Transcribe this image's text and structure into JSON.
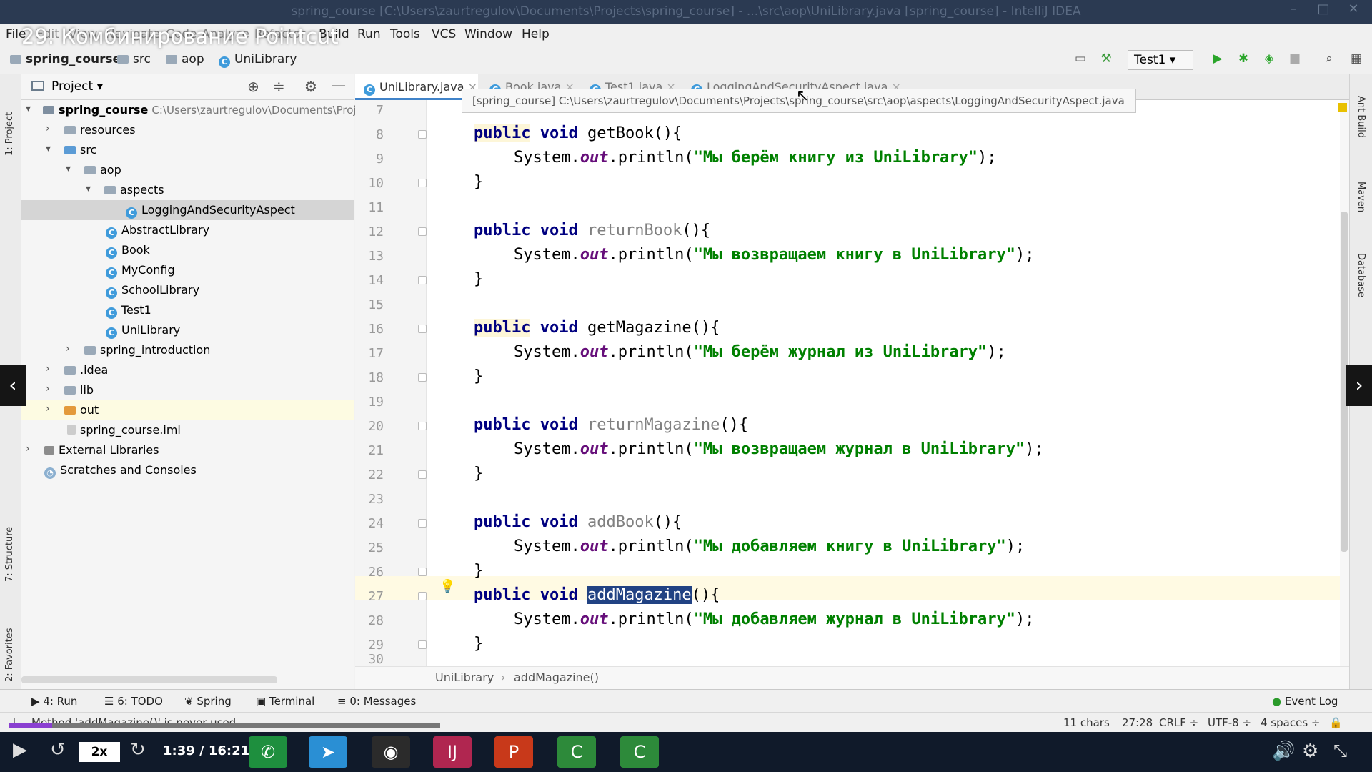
{
  "window": {
    "title": "spring_course [C:\\Users\\zaurtregulov\\Documents\\Projects\\spring_course] - ...\\src\\aop\\UniLibrary.java [spring_course] - IntelliJ IDEA"
  },
  "video": {
    "lesson_title": "29. Комбинирование Pointcut",
    "speed": "2x",
    "time": "1:39 / 16:21",
    "progress": 0.101
  },
  "menu": [
    "File",
    "Edit",
    "View",
    "Navigate",
    "Code",
    "Analyze",
    "Refactor",
    "Build",
    "Run",
    "Tools",
    "VCS",
    "Window",
    "Help"
  ],
  "breadcrumb": [
    "spring_course",
    "src",
    "aop",
    "UniLibrary"
  ],
  "run_config": "Test1",
  "project": {
    "header": "Project",
    "tree": [
      {
        "label": "spring_course",
        "hint": "C:\\Users\\zaurtregulov\\Documents\\Proj"
      },
      {
        "label": "resources"
      },
      {
        "label": "src"
      },
      {
        "label": "aop"
      },
      {
        "label": "aspects"
      },
      {
        "label": "LoggingAndSecurityAspect"
      },
      {
        "label": "AbstractLibrary"
      },
      {
        "label": "Book"
      },
      {
        "label": "MyConfig"
      },
      {
        "label": "SchoolLibrary"
      },
      {
        "label": "Test1"
      },
      {
        "label": "UniLibrary"
      },
      {
        "label": "spring_introduction"
      },
      {
        "label": ".idea"
      },
      {
        "label": "lib"
      },
      {
        "label": "out"
      },
      {
        "label": "spring_course.iml"
      },
      {
        "label": "External Libraries"
      },
      {
        "label": "Scratches and Consoles"
      }
    ]
  },
  "tabs": [
    "UniLibrary.java",
    "Book.java",
    "Test1.java",
    "LoggingAndSecurityAspect.java"
  ],
  "tooltip": "[spring_course] C:\\Users\\zaurtregulov\\Documents\\Projects\\spring_course\\src\\aop\\aspects\\LoggingAndSecurityAspect.java",
  "code": {
    "line_numbers": [
      "7",
      "8",
      "9",
      "10",
      "11",
      "12",
      "13",
      "14",
      "15",
      "16",
      "17",
      "18",
      "19",
      "20",
      "21",
      "22",
      "23",
      "24",
      "25",
      "26",
      "27",
      "28",
      "29",
      "30"
    ],
    "kw_public": "public",
    "kw_void": "void",
    "sys": "System.",
    "out": "out",
    "println": ".println(",
    "close_stmt": ");",
    "parens": "(){",
    "brace": "}",
    "methods": [
      "getBook",
      "returnBook",
      "getMagazine",
      "returnMagazine",
      "addBook",
      "addMagazine"
    ],
    "strings": [
      "\"Мы берём книгу из UniLibrary\"",
      "\"Мы возвращаем книгу в UniLibrary\"",
      "\"Мы берём журнал из UniLibrary\"",
      "\"Мы возвращаем журнал в UniLibrary\"",
      "\"Мы добавляем книгу в UniLibrary\"",
      "\"Мы добавляем журнал в UniLibrary\""
    ]
  },
  "editor_breadcrumb": [
    "UniLibrary",
    "addMagazine()"
  ],
  "side_left": [
    "1: Project",
    "7: Structure",
    "2: Favorites"
  ],
  "side_right": [
    "Ant Build",
    "Maven",
    "Database"
  ],
  "toolwindows": [
    "4: Run",
    "6: TODO",
    "Spring",
    "Terminal",
    "0: Messages"
  ],
  "event_log": "Event Log",
  "status": {
    "message": "Method 'addMagazine()' is never used",
    "chars": "11 chars",
    "position": "27:28",
    "line_sep": "CRLF ÷",
    "encoding": "UTF-8 ÷",
    "indent": "4 spaces ÷"
  }
}
